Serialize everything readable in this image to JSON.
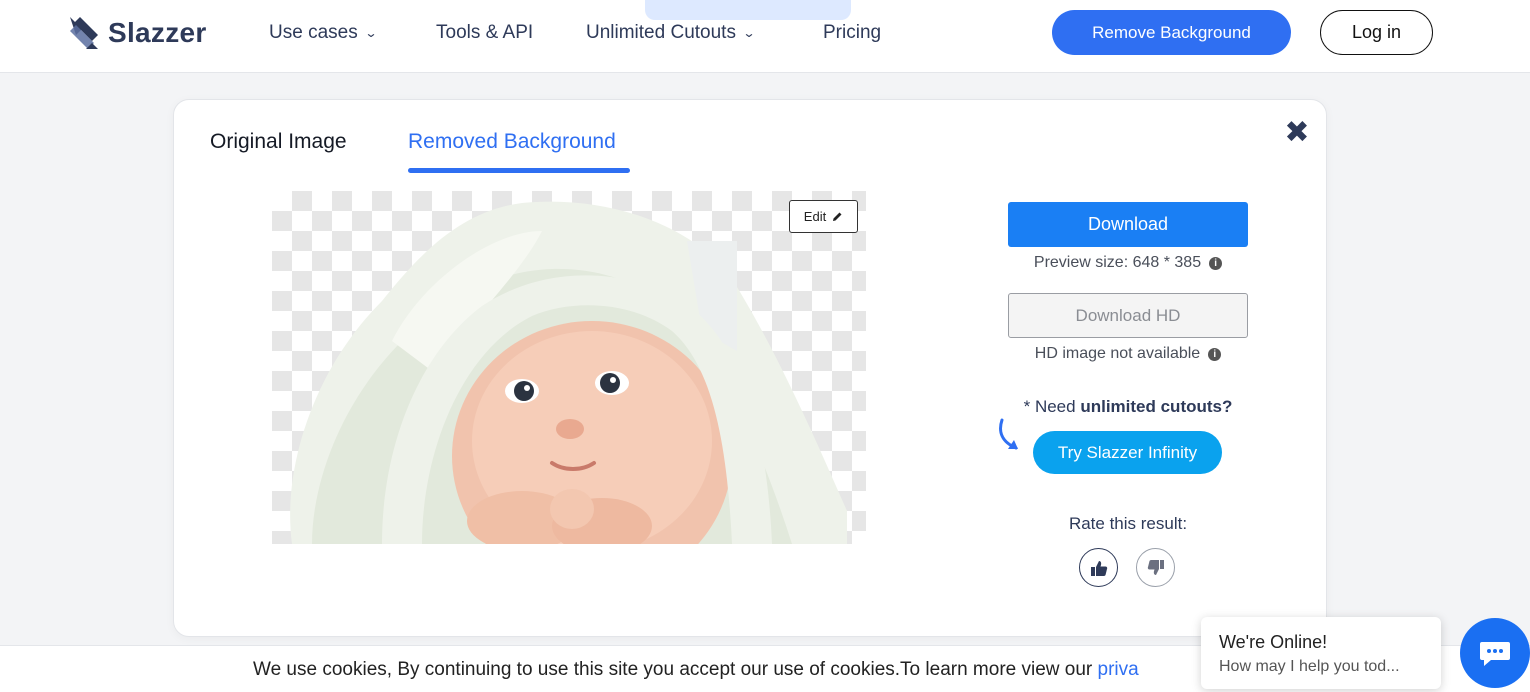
{
  "header": {
    "logo_text": "Slazzer",
    "nav": [
      {
        "label": "Use cases",
        "has_dropdown": true
      },
      {
        "label": "Tools & API",
        "has_dropdown": false
      },
      {
        "label": "Unlimited Cutouts",
        "has_dropdown": true
      },
      {
        "label": "Pricing",
        "has_dropdown": false
      }
    ],
    "remove_bg_label": "Remove Background",
    "login_label": "Log in"
  },
  "modal": {
    "tabs": [
      {
        "label": "Original Image",
        "active": false
      },
      {
        "label": "Removed Background",
        "active": true
      }
    ],
    "close_icon": "close-icon",
    "edit_label": "Edit",
    "download_label": "Download",
    "preview_size": "Preview size: 648 * 385",
    "download_hd_label": "Download HD",
    "hd_note": "HD image not available",
    "need_prefix": "* Need",
    "need_bold": "unlimited cutouts?",
    "try_label": "Try Slazzer Infinity",
    "rate_label": "Rate this result:"
  },
  "cookie": {
    "text": "We use cookies, By continuing to use this site you accept our use of cookies.To learn more view our ",
    "link": "priva"
  },
  "chat": {
    "title": "We're Online!",
    "subtitle": "How may I help you tod..."
  },
  "colors": {
    "accent": "#2f6ff2",
    "download": "#1a7ff4",
    "infinity": "#0aa2ee",
    "dark_text": "#2e3a59"
  }
}
